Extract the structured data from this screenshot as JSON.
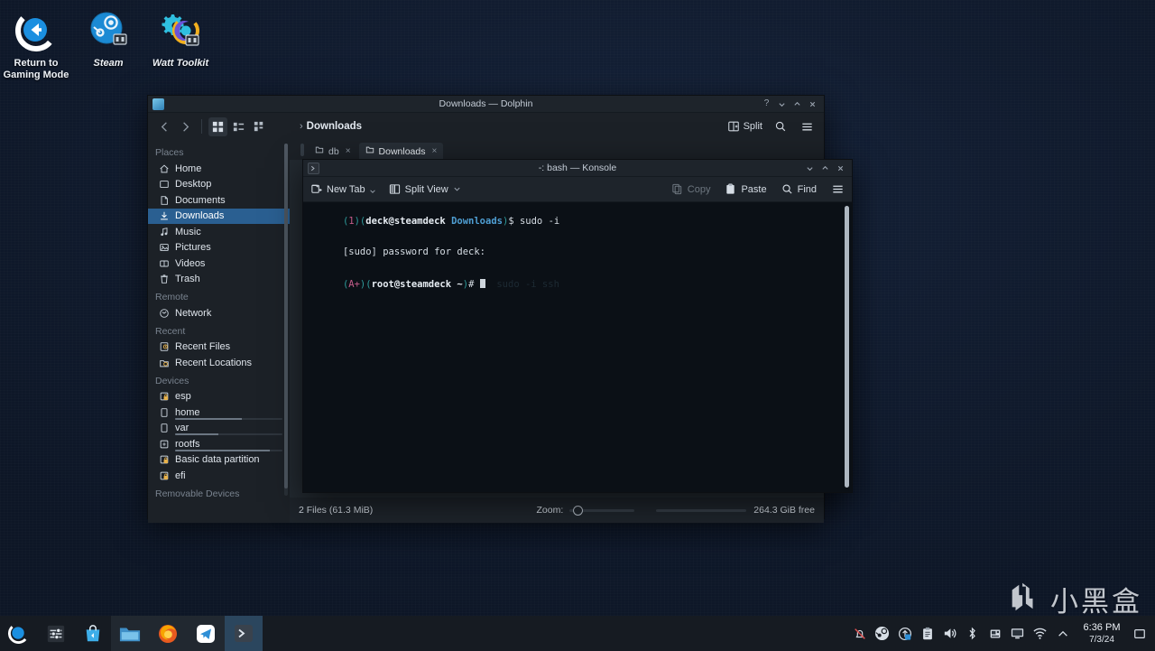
{
  "desktop": {
    "icons": [
      {
        "name": "return-to-gaming-mode",
        "label": "Return to\nGaming Mode",
        "icon": "return-arrow-icon",
        "italic": false
      },
      {
        "name": "steam",
        "label": "Steam",
        "icon": "steam-icon",
        "italic": true
      },
      {
        "name": "watt-toolkit",
        "label": "Watt Toolkit",
        "icon": "watt-toolkit-icon",
        "italic": true
      }
    ],
    "watermark": {
      "text": "小黑盒",
      "logo": "h-logo-icon"
    }
  },
  "dolphin": {
    "title": "Downloads — Dolphin",
    "titlebar_buttons": [
      "help",
      "minimize",
      "maximize",
      "close"
    ],
    "toolbar": {
      "back": "back-icon",
      "forward": "forward-icon",
      "view_modes": [
        "icons-view-icon",
        "compact-view-icon",
        "details-view-icon"
      ],
      "active_view_mode": 0,
      "split_label": "Split",
      "search": "search-icon",
      "menu": "hamburger-menu-icon"
    },
    "breadcrumb": {
      "separator": "›",
      "path": "Downloads"
    },
    "tabs": [
      {
        "label": "db",
        "active": false
      },
      {
        "label": "Downloads",
        "active": true
      }
    ],
    "places": {
      "sections": [
        {
          "header": "Places",
          "items": [
            {
              "label": "Home",
              "icon": "home-icon",
              "selected": false
            },
            {
              "label": "Desktop",
              "icon": "desktop-icon",
              "selected": false
            },
            {
              "label": "Documents",
              "icon": "documents-icon",
              "selected": false
            },
            {
              "label": "Downloads",
              "icon": "downloads-icon",
              "selected": true
            },
            {
              "label": "Music",
              "icon": "music-icon",
              "selected": false
            },
            {
              "label": "Pictures",
              "icon": "pictures-icon",
              "selected": false
            },
            {
              "label": "Videos",
              "icon": "videos-icon",
              "selected": false
            },
            {
              "label": "Trash",
              "icon": "trash-icon",
              "selected": false
            }
          ]
        },
        {
          "header": "Remote",
          "items": [
            {
              "label": "Network",
              "icon": "network-icon",
              "selected": false
            }
          ]
        },
        {
          "header": "Recent",
          "items": [
            {
              "label": "Recent Files",
              "icon": "recent-files-icon",
              "selected": false
            },
            {
              "label": "Recent Locations",
              "icon": "recent-locations-icon",
              "selected": false
            }
          ]
        },
        {
          "header": "Devices",
          "items": [
            {
              "label": "esp",
              "icon": "drive-locked-icon",
              "selected": false,
              "capacity": 0
            },
            {
              "label": "home",
              "icon": "drive-icon",
              "selected": false,
              "capacity": 62
            },
            {
              "label": "var",
              "icon": "drive-icon",
              "selected": false,
              "capacity": 40
            },
            {
              "label": "rootfs",
              "icon": "drive-root-icon",
              "selected": false,
              "capacity": 88
            },
            {
              "label": "Basic data partition",
              "icon": "drive-locked-icon",
              "selected": false,
              "capacity": 0
            },
            {
              "label": "efi",
              "icon": "drive-locked-icon",
              "selected": false,
              "capacity": 0
            }
          ]
        },
        {
          "header": "Removable Devices",
          "items": []
        }
      ]
    },
    "statusbar": {
      "files": "2 Files (61.3 MiB)",
      "zoom_label": "Zoom:",
      "zoom_value": 8,
      "free_space": "264.3 GiB free"
    }
  },
  "konsole": {
    "title": "-: bash — Konsole",
    "titlebar_buttons": [
      "minimize",
      "maximize",
      "close"
    ],
    "toolbar": {
      "new_tab": "New Tab",
      "split_view": "Split View",
      "copy": "Copy",
      "paste": "Paste",
      "find": "Find",
      "menu": "hamburger-menu-icon"
    },
    "terminal": {
      "lines": [
        {
          "segments": [
            {
              "text": "(",
              "class": "c-paren"
            },
            {
              "text": "1",
              "class": "c-num"
            },
            {
              "text": ")(",
              "class": "c-paren"
            },
            {
              "text": "deck@steamdeck ",
              "class": "c-user"
            },
            {
              "text": "Downloads",
              "class": "c-dir"
            },
            {
              "text": ")",
              "class": "c-paren"
            },
            {
              "text": "$ sudo -i",
              "class": "c-plain"
            }
          ]
        },
        {
          "segments": [
            {
              "text": "[sudo] password for deck:",
              "class": "c-plain"
            }
          ]
        },
        {
          "segments": [
            {
              "text": "(",
              "class": "c-paren"
            },
            {
              "text": "A+",
              "class": "c-num"
            },
            {
              "text": ")(",
              "class": "c-paren"
            },
            {
              "text": "root@steamdeck ~",
              "class": "c-user"
            },
            {
              "text": ")",
              "class": "c-paren"
            },
            {
              "text": "# ",
              "class": "c-plain"
            }
          ],
          "cursor": true,
          "ghost": "  sudo -i ssh"
        }
      ]
    }
  },
  "taskbar": {
    "launchers": [
      {
        "name": "application-launcher",
        "icon": "steamos-launcher-icon"
      },
      {
        "name": "system-settings",
        "icon": "sliders-icon"
      },
      {
        "name": "discover-store",
        "icon": "discover-bag-icon"
      }
    ],
    "tasks": [
      {
        "name": "dolphin",
        "icon": "dolphin-folder-icon",
        "state": "running"
      },
      {
        "name": "firefox",
        "icon": "firefox-icon",
        "state": "running"
      },
      {
        "name": "telegram",
        "icon": "telegram-icon",
        "state": "running"
      },
      {
        "name": "konsole",
        "icon": "konsole-icon",
        "state": "focused"
      }
    ],
    "tray": [
      {
        "name": "notifications-muted",
        "icon": "bell-muted-icon"
      },
      {
        "name": "steam-tray",
        "icon": "steam-icon"
      },
      {
        "name": "updates",
        "icon": "update-arrow-icon"
      },
      {
        "name": "clipboard",
        "icon": "clipboard-icon"
      },
      {
        "name": "volume",
        "icon": "speaker-icon"
      },
      {
        "name": "bluetooth",
        "icon": "bluetooth-icon"
      },
      {
        "name": "removable-media",
        "icon": "usb-drive-icon"
      },
      {
        "name": "display-config",
        "icon": "monitor-icon"
      },
      {
        "name": "network-wifi",
        "icon": "wifi-icon"
      },
      {
        "name": "show-hidden-tray",
        "icon": "chevron-up-icon"
      }
    ],
    "clock": {
      "time": "6:36 PM",
      "date": "7/3/24"
    },
    "show_desktop": "show-desktop-icon"
  }
}
